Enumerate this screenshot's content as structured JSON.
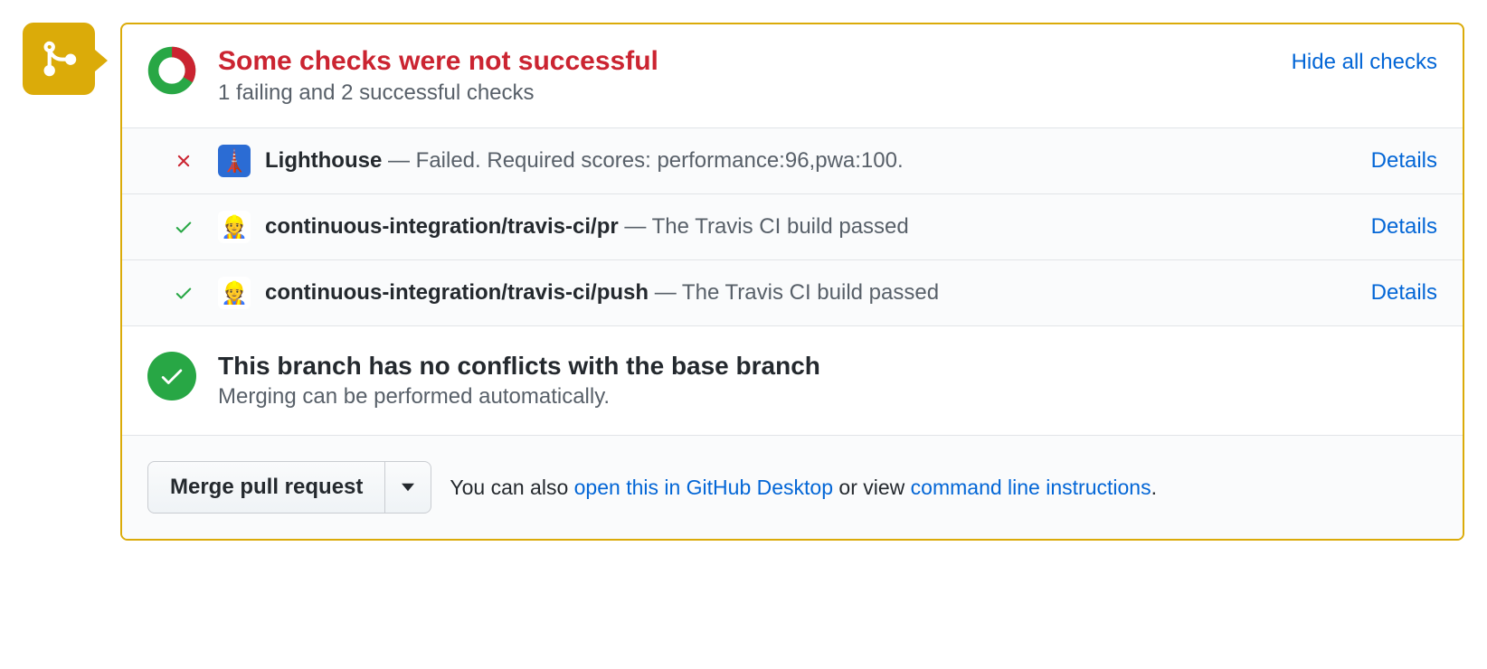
{
  "summary": {
    "title": "Some checks were not successful",
    "subtitle": "1 failing and 2 successful checks",
    "hide_link": "Hide all checks"
  },
  "checks": [
    {
      "status": "fail",
      "name": "Lighthouse",
      "desc": " — Failed. Required scores: performance:96,pwa:100.",
      "details": "Details",
      "avatar_emoji": "🗼",
      "avatar_bg": "#2b6cd4"
    },
    {
      "status": "pass",
      "name": "continuous-integration/travis-ci/pr",
      "desc": " — The Travis CI build passed",
      "details": "Details",
      "avatar_emoji": "👷",
      "avatar_bg": "#ffffff"
    },
    {
      "status": "pass",
      "name": "continuous-integration/travis-ci/push",
      "desc": " — The Travis CI build passed",
      "details": "Details",
      "avatar_emoji": "👷",
      "avatar_bg": "#ffffff"
    }
  ],
  "conflicts": {
    "title": "This branch has no conflicts with the base branch",
    "subtitle": "Merging can be performed automatically."
  },
  "merge": {
    "button": "Merge pull request",
    "alt_prefix": "You can also ",
    "alt_desktop": "open this in GitHub Desktop",
    "alt_mid": " or view ",
    "alt_cli": "command line instructions",
    "alt_suffix": "."
  }
}
